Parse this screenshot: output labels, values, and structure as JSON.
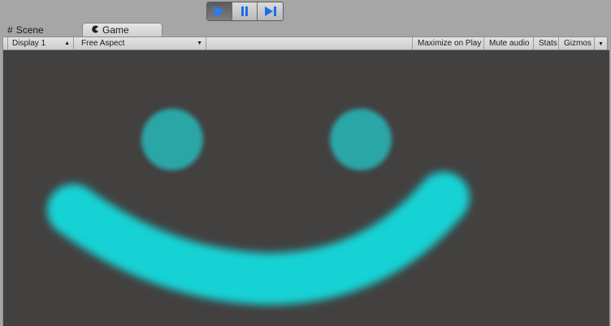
{
  "play_controls": [
    {
      "name": "play",
      "icon": "play-icon",
      "active": true
    },
    {
      "name": "pause",
      "icon": "pause-icon",
      "active": false
    },
    {
      "name": "step",
      "icon": "step-icon",
      "active": false
    }
  ],
  "tabs": {
    "scene": {
      "label": "Scene",
      "icon": "grid-icon"
    },
    "game": {
      "label": "Game",
      "icon": "pacman-icon"
    }
  },
  "toolbar": {
    "display": "Display 1",
    "aspect": "Free Aspect",
    "maximize": "Maximize on Play",
    "mute": "Mute audio",
    "stats": "Stats",
    "gizmos": "Gizmos"
  },
  "colors": {
    "background": "#434040",
    "eyes": "#29a6a6",
    "mouth": "#16d2d4",
    "accent_blue": "#1a6ee8"
  }
}
